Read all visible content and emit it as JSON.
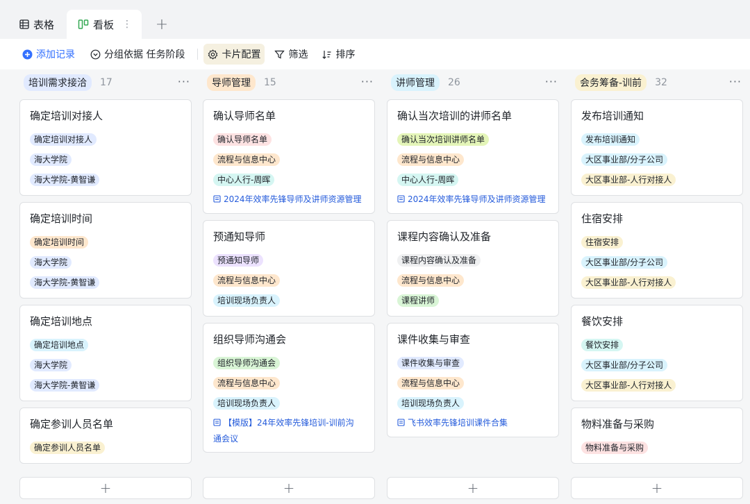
{
  "tabs": [
    {
      "label": "表格",
      "icon": "grid-icon"
    },
    {
      "label": "看板",
      "icon": "kanban-icon",
      "more": "⋮"
    }
  ],
  "toolbar": {
    "add_record": "添加记录",
    "group_by": "分组依据 任务阶段",
    "card_config": "卡片配置",
    "filter": "筛选",
    "sort": "排序"
  },
  "columns": [
    {
      "title": "培训需求接洽",
      "count": "17",
      "tag_color": "#e1eaff",
      "cards": [
        {
          "title": "确定培训对接人",
          "chips": [
            {
              "text": "确定培训对接人",
              "color": "c-blue"
            },
            {
              "text": "海大学院",
              "color": "c-blue"
            },
            {
              "text": "海大学院-黄智谦",
              "color": "c-blue"
            }
          ]
        },
        {
          "title": "确定培训时间",
          "chips": [
            {
              "text": "确定培训时间",
              "color": "c-orange"
            },
            {
              "text": "海大学院",
              "color": "c-blue"
            },
            {
              "text": "海大学院-黄智谦",
              "color": "c-blue"
            }
          ]
        },
        {
          "title": "确定培训地点",
          "chips": [
            {
              "text": "确定培训地点",
              "color": "c-lightblue"
            },
            {
              "text": "海大学院",
              "color": "c-blue"
            },
            {
              "text": "海大学院-黄智谦",
              "color": "c-blue"
            }
          ]
        },
        {
          "title": "确定参训人员名单",
          "chips": [
            {
              "text": "确定参训人员名单",
              "color": "c-yellow"
            }
          ]
        }
      ]
    },
    {
      "title": "导师管理",
      "count": "15",
      "tag_color": "#fee7cd",
      "cards": [
        {
          "title": "确认导师名单",
          "chips": [
            {
              "text": "确认导师名单",
              "color": "c-pink"
            },
            {
              "text": "流程与信息中心",
              "color": "c-orange"
            },
            {
              "text": "中心人行-周晖",
              "color": "c-teal"
            }
          ],
          "link": "2024年效率先锋导师及讲师资源管理"
        },
        {
          "title": "预通知导师",
          "chips": [
            {
              "text": "预通知导师",
              "color": "c-purple"
            },
            {
              "text": "流程与信息中心",
              "color": "c-orange"
            },
            {
              "text": "培训现场负责人",
              "color": "c-lightblue"
            }
          ]
        },
        {
          "title": "组织导师沟通会",
          "chips": [
            {
              "text": "组织导师沟通会",
              "color": "c-green"
            },
            {
              "text": "流程与信息中心",
              "color": "c-orange"
            },
            {
              "text": "培训现场负责人",
              "color": "c-lightblue"
            }
          ],
          "link": "【模版】24年效率先锋培训-训前沟通会议"
        }
      ]
    },
    {
      "title": "讲师管理",
      "count": "26",
      "tag_color": "#d9f3fd",
      "cards": [
        {
          "title": "确认当次培训的讲师名单",
          "chips": [
            {
              "text": "确认当次培训讲师名单",
              "color": "c-lime"
            },
            {
              "text": "流程与信息中心",
              "color": "c-orange"
            },
            {
              "text": "中心人行-周晖",
              "color": "c-teal"
            }
          ],
          "link": "2024年效率先锋导师及讲师资源管理"
        },
        {
          "title": "课程内容确认及准备",
          "chips": [
            {
              "text": "课程内容确认及准备",
              "color": "c-grey"
            },
            {
              "text": "流程与信息中心",
              "color": "c-orange"
            },
            {
              "text": "课程讲师",
              "color": "c-green"
            }
          ]
        },
        {
          "title": "课件收集与审查",
          "chips": [
            {
              "text": "课件收集与审查",
              "color": "c-blue"
            },
            {
              "text": "流程与信息中心",
              "color": "c-orange"
            },
            {
              "text": "培训现场负责人",
              "color": "c-lightblue"
            }
          ],
          "link": "飞书效率先锋培训课件合集"
        }
      ]
    },
    {
      "title": "会务筹备-训前",
      "count": "32",
      "tag_color": "#faf1d1",
      "cards": [
        {
          "title": "发布培训通知",
          "chips": [
            {
              "text": "发布培训通知",
              "color": "c-lightblue"
            },
            {
              "text": "大区事业部/分子公司",
              "color": "c-lightblue"
            },
            {
              "text": "大区事业部-人行对接人",
              "color": "c-yellow"
            }
          ]
        },
        {
          "title": "住宿安排",
          "chips": [
            {
              "text": "住宿安排",
              "color": "c-yellow"
            },
            {
              "text": "大区事业部/分子公司",
              "color": "c-lightblue"
            },
            {
              "text": "大区事业部-人行对接人",
              "color": "c-yellow"
            }
          ]
        },
        {
          "title": "餐饮安排",
          "chips": [
            {
              "text": "餐饮安排",
              "color": "c-teal"
            },
            {
              "text": "大区事业部/分子公司",
              "color": "c-lightblue"
            },
            {
              "text": "大区事业部-人行对接人",
              "color": "c-yellow"
            }
          ]
        },
        {
          "title": "物料准备与采购",
          "chips": [
            {
              "text": "物料准备与采购",
              "color": "c-pink"
            }
          ]
        }
      ]
    }
  ],
  "add_card_label": "+",
  "add_tab_label": "+",
  "column_more": "···"
}
